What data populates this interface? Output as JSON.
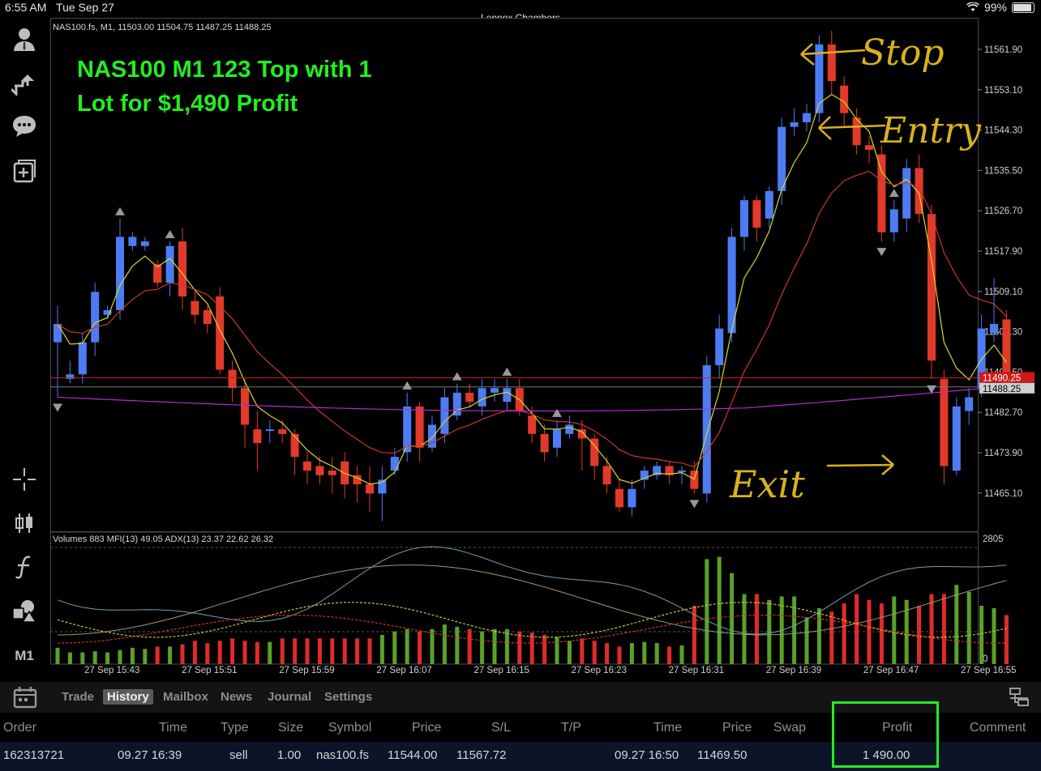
{
  "status": {
    "time": "6:55 AM",
    "date": "Tue Sep 27",
    "center_title": "Lennox Chambers",
    "battery": "99%"
  },
  "chart": {
    "header_text": "NAS100.fs, M1, 11503.00 11504.75 11487.25 11488.25",
    "title_line1": "NAS100 M1 123 Top with 1",
    "title_line2": "Lot for $1,490 Profit",
    "price_levels": [
      "11561.90",
      "11553.10",
      "11544.30",
      "11535.50",
      "11526.70",
      "11517.90",
      "11509.10",
      "11500.30",
      "11491.50",
      "11482.70",
      "11473.90",
      "11465.10"
    ],
    "price_red_tag": "11490.25",
    "price_gray_tag": "11488.25",
    "indicator_header": "Volumes 883 MFI(13) 49.05 ADX(13) 23.37 22.62 26.32",
    "indicator_max": "2805",
    "indicator_min": "0",
    "time_labels": [
      "27 Sep 15:43",
      "27 Sep 15:51",
      "27 Sep 15:59",
      "27 Sep 16:07",
      "27 Sep 16:15",
      "27 Sep 16:23",
      "27 Sep 16:31",
      "27 Sep 16:39",
      "27 Sep 16:47",
      "27 Sep 16:55"
    ],
    "annotations": {
      "stop": "Stop",
      "entry": "Entry",
      "exit": "Exit"
    },
    "colors": {
      "bull": "#4d7cf2",
      "bear": "#e23a2a",
      "ma_fast": "#d6d62e",
      "ma_slow": "#c8382a",
      "ma_long": "#b42bd0",
      "annotation": "#d9b21c",
      "title": "#22ee22"
    }
  },
  "tabs": [
    "Trade",
    "History",
    "Mailbox",
    "News",
    "Journal",
    "Settings"
  ],
  "active_tab": "History",
  "history": {
    "columns": [
      "Order",
      "Time",
      "Type",
      "Size",
      "Symbol",
      "Price",
      "S/L",
      "T/P",
      "Time",
      "Price",
      "Swap",
      "Profit",
      "Comment"
    ],
    "row": {
      "order": "162313721",
      "open_time": "09.27 16:39",
      "type": "sell",
      "size": "1.00",
      "symbol": "nas100.fs",
      "open_price": "11544.00",
      "sl": "11567.72",
      "tp": "",
      "close_time": "09.27 16:50",
      "close_price": "11469.50",
      "swap": "",
      "profit": "1 490.00",
      "comment": ""
    }
  }
}
